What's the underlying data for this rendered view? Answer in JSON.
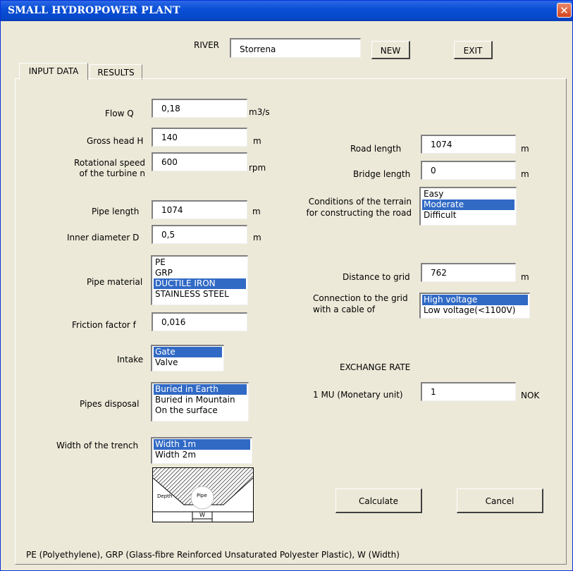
{
  "window": {
    "title": "SMALL HYDROPOWER PLANT",
    "close_symbol": "✕"
  },
  "header": {
    "river_label": "RIVER",
    "river_value": "Storrena",
    "new_button": "NEW",
    "exit_button": "EXIT"
  },
  "tabs": [
    {
      "label": "INPUT DATA",
      "active": true
    },
    {
      "label": "RESULTS",
      "active": false
    }
  ],
  "form": {
    "flow": {
      "label": "Flow Q",
      "value": "0,18",
      "unit": "m3/s"
    },
    "gross_head": {
      "label": "Gross head H",
      "value": "140",
      "unit": "m"
    },
    "rot_speed": {
      "label_line1": "Rotational speed",
      "label_line2": "of the turbine n",
      "value": "600",
      "unit": "rpm"
    },
    "pipe_length": {
      "label": "Pipe length",
      "value": "1074",
      "unit": "m"
    },
    "inner_diameter": {
      "label": "Inner diameter D",
      "value": "0,5",
      "unit": "m"
    },
    "pipe_material": {
      "label": "Pipe material",
      "options": [
        "PE",
        "GRP",
        "DUCTILE IRON",
        "STAINLESS STEEL"
      ],
      "selected": "DUCTILE IRON"
    },
    "friction": {
      "label": "Friction factor f",
      "value": "0,016"
    },
    "intake": {
      "label": "Intake",
      "options": [
        "Gate",
        "Valve"
      ],
      "selected": "Gate"
    },
    "pipes_disposal": {
      "label": "Pipes disposal",
      "options": [
        "Buried in Earth",
        "Buried in Mountain",
        "On the surface"
      ],
      "selected": "Buried in Earth"
    },
    "trench_width": {
      "label": "Width of the trench",
      "options": [
        "Width 1m",
        "Width 2m"
      ],
      "selected": "Width 1m"
    },
    "diagram": {
      "depth": "Depth",
      "pipe": "Pipe",
      "w": "W"
    },
    "road_length": {
      "label": "Road  length",
      "value": "1074",
      "unit": "m"
    },
    "bridge_length": {
      "label": "Bridge length",
      "value": "0",
      "unit": "m"
    },
    "terrain": {
      "label_line1": "Conditions of the terrain",
      "label_line2": "for constructing the road",
      "options": [
        "Easy",
        "Moderate",
        "Difficult"
      ],
      "selected": "Moderate"
    },
    "distance_grid": {
      "label": "Distance  to grid",
      "value": "762",
      "unit": "m"
    },
    "grid_connection": {
      "label_line1": "Connection to the grid",
      "label_line2": "with a cable of",
      "options": [
        "High voltage",
        "Low voltage(<1100V)"
      ],
      "selected": "High voltage"
    },
    "exchange": {
      "heading": "EXCHANGE RATE",
      "label": "1 MU (Monetary unit)",
      "value": "1",
      "unit": "NOK"
    }
  },
  "buttons": {
    "calculate": "Calculate",
    "cancel": "Cancel"
  },
  "footer": {
    "note": "PE (Polyethylene), GRP (Glass-fibre Reinforced Unsaturated Polyester Plastic), W (Width)"
  },
  "colors": {
    "title_bar": "#0a4fd6",
    "selection": "#316ac5",
    "background": "#ece9d8"
  }
}
